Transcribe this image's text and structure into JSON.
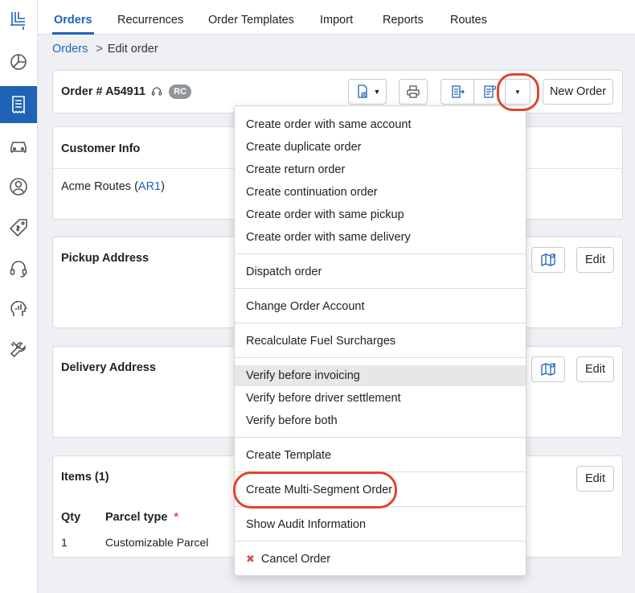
{
  "nav": {
    "tabs": [
      {
        "label": "Orders",
        "active": true
      },
      {
        "label": "Recurrences"
      },
      {
        "label": "Order Templates"
      },
      {
        "label": "Import"
      },
      {
        "label": "Reports"
      },
      {
        "label": "Routes"
      }
    ]
  },
  "breadcrumb": {
    "parent": "Orders",
    "separator": ">",
    "current": "Edit order"
  },
  "order": {
    "title": "Order # A54911",
    "badge": "RC",
    "new_order_label": "New Order"
  },
  "customer": {
    "title": "Customer Info",
    "name": "Acme Routes (",
    "code": "AR1",
    "close": ")"
  },
  "pickup": {
    "title": "Pickup Address",
    "edit_label": "Edit"
  },
  "delivery": {
    "title": "Delivery Address",
    "edit_label": "Edit"
  },
  "items": {
    "title": "Items (1)",
    "edit_label": "Edit",
    "columns": {
      "qty": "Qty",
      "parcel_type": "Parcel type",
      "required_mark": "*"
    },
    "rows": [
      {
        "qty": "1",
        "parcel_type": "Customizable Parcel"
      }
    ]
  },
  "menu": {
    "items": [
      "Create order with same account",
      "Create duplicate order",
      "Create return order",
      "Create continuation order",
      "Create order with same pickup",
      "Create order with same delivery",
      "Dispatch order",
      "Change Order Account",
      "Recalculate Fuel Surcharges",
      "Verify before invoicing",
      "Verify before driver settlement",
      "Verify before both",
      "Create Template",
      "Create Multi-Segment Order",
      "Show Audit Information",
      "Cancel Order"
    ],
    "highlighted": "Verify before invoicing"
  },
  "colors": {
    "accent": "#1f63b7",
    "annotation": "#e0452b",
    "danger": "#d9534f"
  }
}
